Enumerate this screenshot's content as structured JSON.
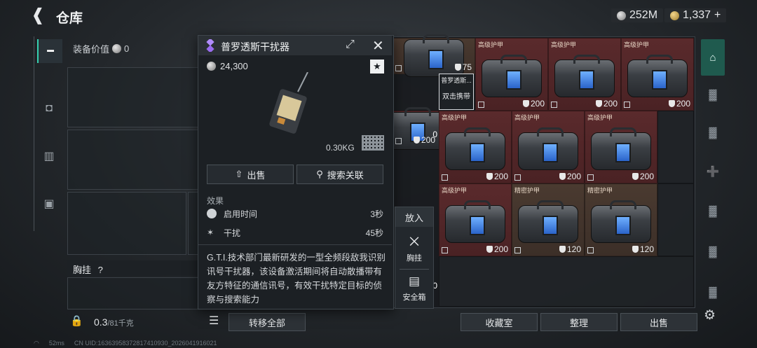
{
  "header": {
    "back_icon": "back-arrow-icon",
    "title": "仓库",
    "currency_silver": "252M",
    "currency_gold": "1,337",
    "add_symbol": "+"
  },
  "equipment": {
    "value_label": "装备价值",
    "value": "0",
    "chest_label": "胸挂",
    "help": "?"
  },
  "capacity": {
    "used": "0.3",
    "total": "/81千克"
  },
  "bottom_buttons": {
    "transfer_all": "转移全部",
    "collection": "收藏室",
    "organize": "整理",
    "sell": "出售"
  },
  "status_bar": {
    "ping": "52ms",
    "uid": "CN UID:16363958372817410930_2026041916021"
  },
  "popup": {
    "title": "普罗透斯干扰器",
    "value": "24,300",
    "weight": "0.30KG",
    "sell_button": "出售",
    "search_button": "搜索关联",
    "effects_heading": "效果",
    "effects": [
      {
        "name": "启用时间",
        "value": "3秒"
      },
      {
        "name": "干扰",
        "value": "45秒"
      }
    ],
    "description": "G.T.I.技术部门最新研发的一型全频段敌我识别讯号干扰器，该设备激活期间将自动散播带有友方特征的通信讯号，有效干扰特定目标的侦察与搜索能力"
  },
  "put_in_menu": {
    "heading": "放入",
    "items": [
      {
        "label": "胸挂",
        "icon": "chest-rig-icon"
      },
      {
        "label": "安全箱",
        "icon": "safe-box-icon"
      }
    ]
  },
  "storage": {
    "slot_overlay": {
      "name": "普罗透斯...",
      "hint": "双击携带"
    },
    "items": [
      {
        "label": "",
        "durability": "75"
      },
      {
        "label": "高级护甲",
        "durability": "200"
      },
      {
        "label": "高级护甲",
        "durability": "200"
      },
      {
        "label": "高级护甲",
        "durability": "200"
      },
      {
        "label": "",
        "durability": "200"
      },
      {
        "label": "高级护甲",
        "durability": "200"
      },
      {
        "label": "高级护甲",
        "durability": "200"
      },
      {
        "label": "高级护甲",
        "durability": "200"
      },
      {
        "label": "高级护甲",
        "durability": "200"
      },
      {
        "label": "精密护甲",
        "durability": "120"
      },
      {
        "label": "精密护甲",
        "durability": "120"
      }
    ],
    "partial_values": [
      "0",
      "0"
    ]
  },
  "colors": {
    "accent": "#35d0b0",
    "armor_red": "#5a2a2c",
    "armor_brown": "#4a3a30"
  }
}
